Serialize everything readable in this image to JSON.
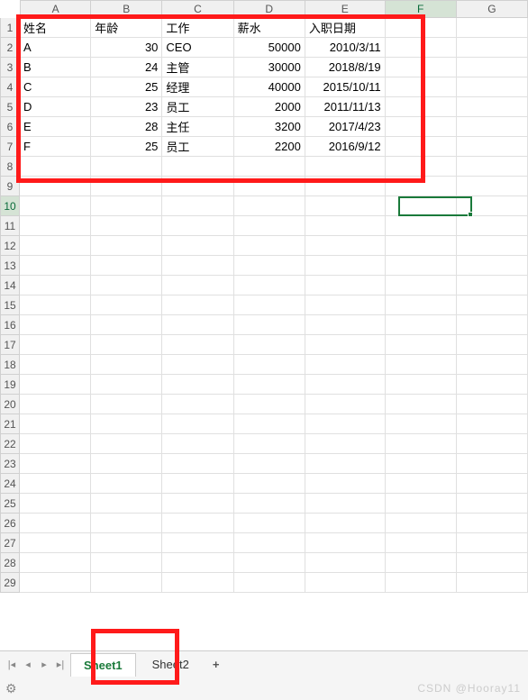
{
  "columns": [
    "A",
    "B",
    "C",
    "D",
    "E",
    "F",
    "G"
  ],
  "rows": [
    "1",
    "2",
    "3",
    "4",
    "5",
    "6",
    "7",
    "8",
    "9",
    "10",
    "11",
    "12",
    "13",
    "14",
    "15",
    "16",
    "17",
    "18",
    "19",
    "20",
    "21",
    "22",
    "23",
    "24",
    "25",
    "26",
    "27",
    "28",
    "29"
  ],
  "selectedCol": "F",
  "selectedRow": "10",
  "headers": [
    "姓名",
    "年龄",
    "工作",
    "薪水",
    "入职日期"
  ],
  "data": [
    {
      "name": "A",
      "age": "30",
      "job": "CEO",
      "salary": "50000",
      "date": "2010/3/11"
    },
    {
      "name": "B",
      "age": "24",
      "job": "主管",
      "salary": "30000",
      "date": "2018/8/19"
    },
    {
      "name": "C",
      "age": "25",
      "job": "经理",
      "salary": "40000",
      "date": "2015/10/11"
    },
    {
      "name": "D",
      "age": "23",
      "job": "员工",
      "salary": "2000",
      "date": "2011/11/13"
    },
    {
      "name": "E",
      "age": "28",
      "job": "主任",
      "salary": "3200",
      "date": "2017/4/23"
    },
    {
      "name": "F",
      "age": "25",
      "job": "员工",
      "salary": "2200",
      "date": "2016/9/12"
    }
  ],
  "sheets": {
    "active": "Sheet1",
    "other": "Sheet2",
    "add": "+"
  },
  "nav": {
    "first": "|◂",
    "prev": "◂",
    "next": "▸",
    "last": "▸|"
  },
  "watermark": "CSDN @Hooray11",
  "statusIcon": "⚙"
}
